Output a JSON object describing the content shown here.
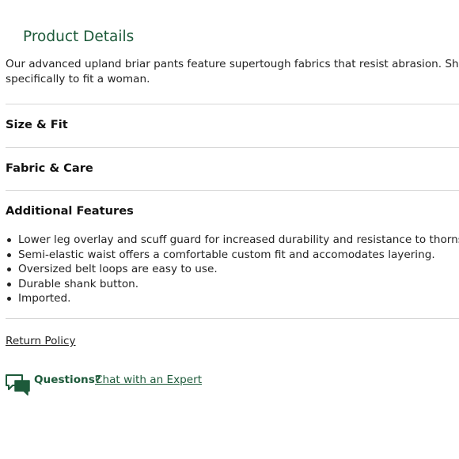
{
  "product_details": {
    "title": "Product Details",
    "description": "Our advanced upland briar pants feature supertough fabrics that resist abrasion. Shaped specifically to fit a woman."
  },
  "sections": {
    "size_fit": "Size & Fit",
    "fabric_care": "Fabric & Care",
    "additional_features": "Additional Features"
  },
  "features": [
    "Lower leg overlay and scuff guard for increased durability and resistance to thorns.",
    "Semi-elastic waist offers a comfortable custom fit and accomodates layering.",
    "Oversized belt loops are easy to use.",
    "Durable shank button.",
    "Imported."
  ],
  "links": {
    "return_policy": "Return Policy"
  },
  "questions": {
    "label": "Questions?",
    "link": "Chat with an Expert"
  },
  "colors": {
    "accent_green": "#1d5a3a",
    "divider": "#d7d7d7"
  },
  "icons": {
    "chat": "chat-bubbles-icon"
  }
}
